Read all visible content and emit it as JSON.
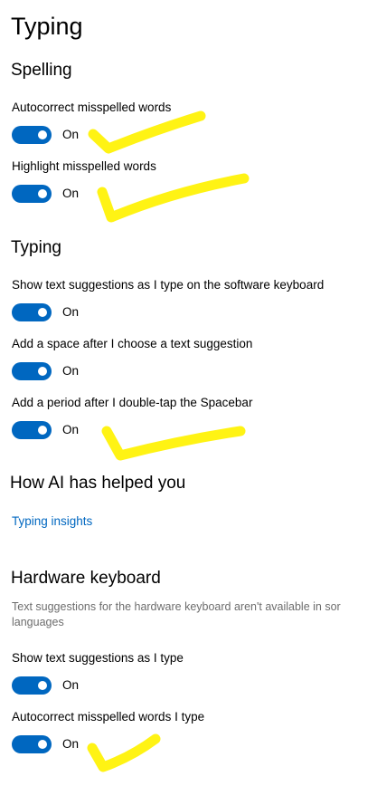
{
  "page": {
    "title": "Typing"
  },
  "colors": {
    "accent": "#0067c0",
    "annotation": "#fff200",
    "description_text": "#6d6d6d"
  },
  "spelling": {
    "header": "Spelling",
    "settings": [
      {
        "label": "Autocorrect misspelled words",
        "state": "On",
        "enabled": true
      },
      {
        "label": "Highlight misspelled words",
        "state": "On",
        "enabled": true
      }
    ]
  },
  "typing": {
    "header": "Typing",
    "settings": [
      {
        "label": "Show text suggestions as I type on the software keyboard",
        "state": "On",
        "enabled": true
      },
      {
        "label": "Add a space after I choose a text suggestion",
        "state": "On",
        "enabled": true
      },
      {
        "label": "Add a period after I double-tap the Spacebar",
        "state": "On",
        "enabled": true
      }
    ]
  },
  "ai": {
    "header": "How AI has helped you",
    "link": "Typing insights"
  },
  "hardware": {
    "header": "Hardware keyboard",
    "description_line1": "Text suggestions for the hardware keyboard aren't available in sor",
    "description_line2": "languages",
    "settings": [
      {
        "label": "Show text suggestions as I type",
        "state": "On",
        "enabled": true
      },
      {
        "label": "Autocorrect misspelled words I type",
        "state": "On",
        "enabled": true
      }
    ]
  }
}
